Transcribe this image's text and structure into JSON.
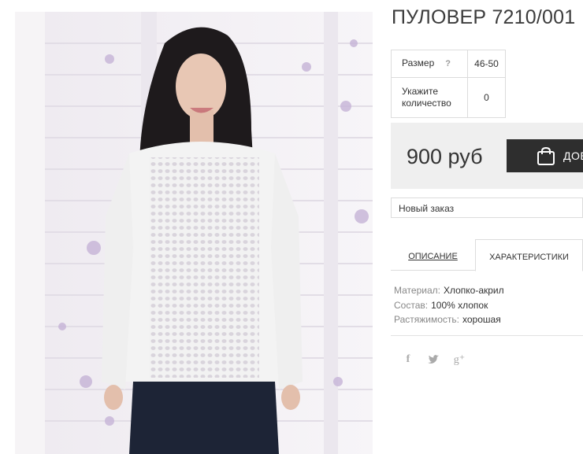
{
  "product": {
    "title": "ПУЛОВЕР 7210/001",
    "options": [
      {
        "label": "Размер",
        "help": "?",
        "value": "46-50"
      },
      {
        "label": "Укажите количество",
        "value": "0"
      }
    ],
    "price": "900 руб",
    "buy_label": "ДОБ",
    "order_select": "Новый заказ"
  },
  "tabs": [
    {
      "label": "ОПИСАНИЕ",
      "active": false
    },
    {
      "label": "ХАРАКТЕРИСТИКИ",
      "active": true
    }
  ],
  "specs": [
    {
      "key": "Материал:",
      "value": "Хлопко-акрил"
    },
    {
      "key": "Состав:",
      "value": "100% хлопок"
    },
    {
      "key": "Растяжимость:",
      "value": "хорошая"
    }
  ],
  "social": [
    {
      "name": "facebook",
      "glyph": "f"
    },
    {
      "name": "twitter",
      "glyph": "t"
    },
    {
      "name": "google-plus",
      "glyph": "g⁺"
    }
  ],
  "colors": {
    "button_bg": "#2e2e2e",
    "price_box_bg": "#efefef",
    "border": "#dcdcdc"
  }
}
